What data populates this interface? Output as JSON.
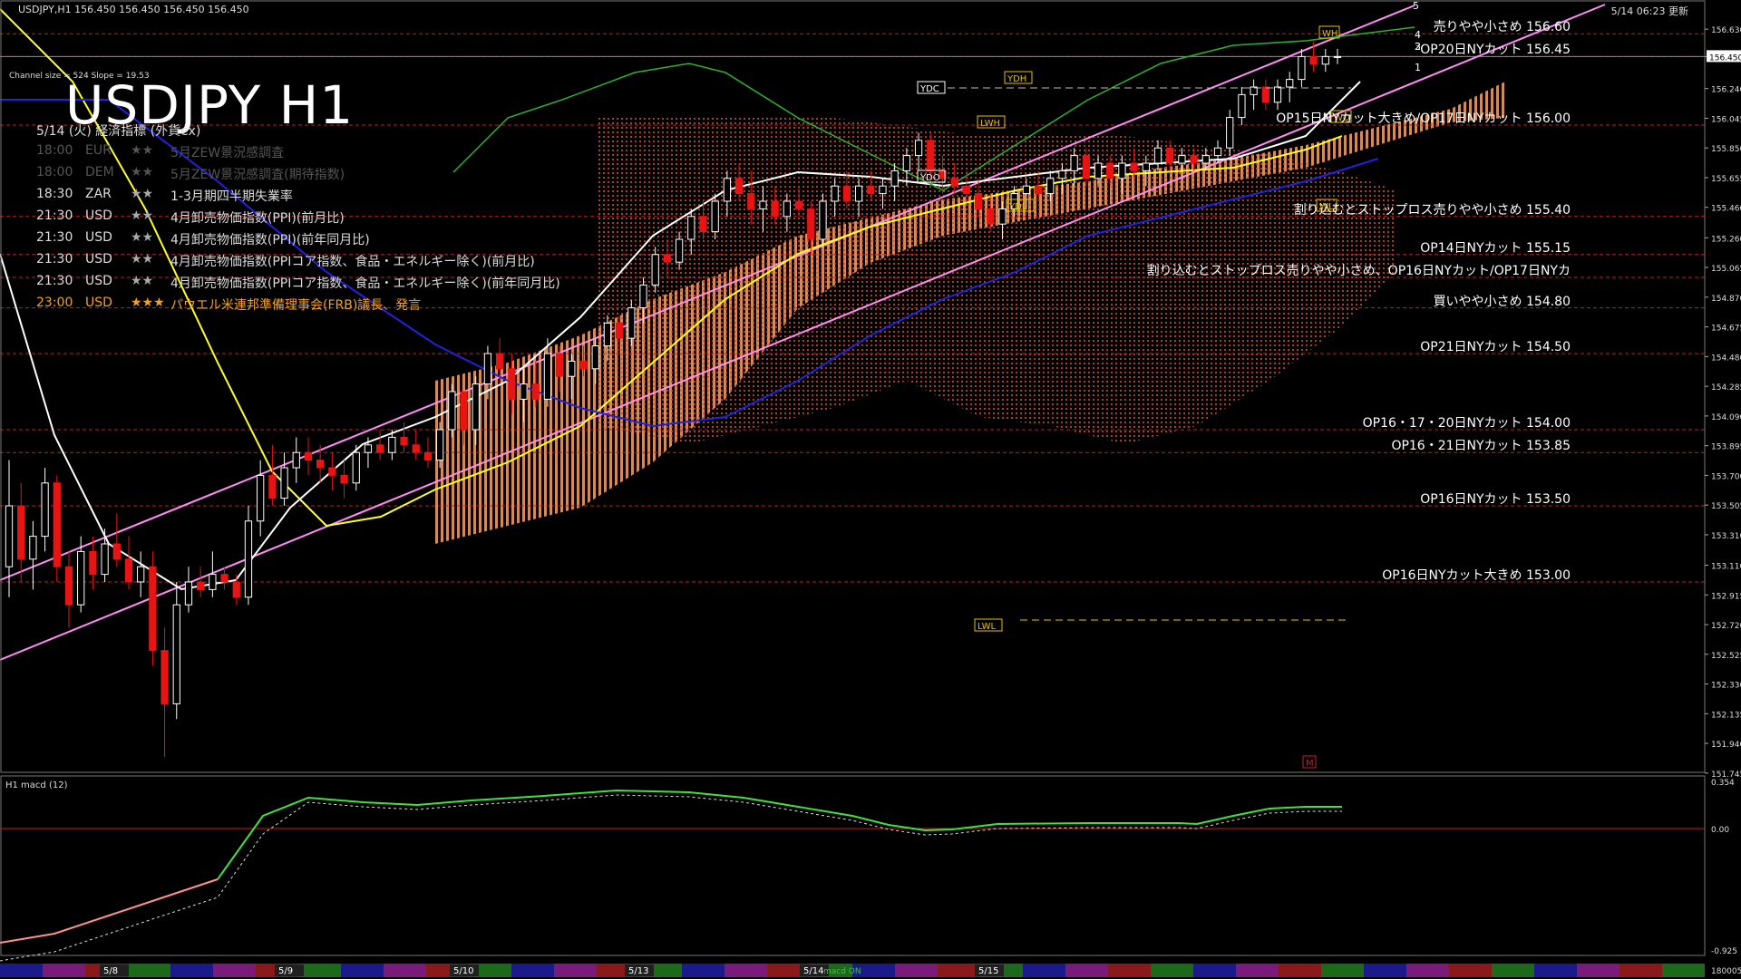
{
  "header": {
    "symbol_info": "USDJPY,H1  156.450 156.450 156.450 156.450",
    "channel_info": "Channel size = 524 Slope = 19.53",
    "title": "USDJPY H1",
    "timestamp": "5/14 06:23 更新"
  },
  "events": {
    "heading": "5/14 (火) 経済指標 (外貨ex)",
    "items": [
      {
        "time": "18:00",
        "ccy": "EUR",
        "stars": "★★",
        "text": "5月ZEW景況感調査",
        "past": true,
        "gold": false
      },
      {
        "time": "18:00",
        "ccy": "DEM",
        "stars": "★★",
        "text": "5月ZEW景況感調査(期待指数)",
        "past": true,
        "gold": false
      },
      {
        "time": "18:30",
        "ccy": "ZAR",
        "stars": "★★",
        "text": "1-3月期四半期失業率",
        "past": false,
        "gold": false
      },
      {
        "time": "21:30",
        "ccy": "USD",
        "stars": "★★",
        "text": "4月卸売物価指数(PPI)(前月比)",
        "past": false,
        "gold": false
      },
      {
        "time": "21:30",
        "ccy": "USD",
        "stars": "★★",
        "text": "4月卸売物価指数(PPI)(前年同月比)",
        "past": false,
        "gold": false
      },
      {
        "time": "21:30",
        "ccy": "USD",
        "stars": "★★",
        "text": "4月卸売物価指数(PPIコア指数、食品・エネルギー除く)(前月比)",
        "past": false,
        "gold": false
      },
      {
        "time": "21:30",
        "ccy": "USD",
        "stars": "★★",
        "text": "4月卸売物価指数(PPIコア指数、食品・エネルギー除く)(前年同月比)",
        "past": false,
        "gold": false
      },
      {
        "time": "23:00",
        "ccy": "USD",
        "stars": "★★★",
        "text": "パウエル米連邦準備理事会(FRB)議長、発言",
        "past": false,
        "gold": true
      }
    ]
  },
  "levels": [
    {
      "price": 156.6,
      "text": "売りやや小さめ 156.60"
    },
    {
      "price": 156.45,
      "text": "OP20日NYカット 156.45"
    },
    {
      "price": 156.0,
      "text": "OP15日NYカット大きめ/OP17日NYカット 156.00"
    },
    {
      "price": 155.4,
      "text": "割り込むとストップロス売りやや小さめ 155.40"
    },
    {
      "price": 155.15,
      "text": "OP14日NYカット 155.15"
    },
    {
      "price": 155.0,
      "text": "割り込むとストップロス売りやや小さめ、OP16日NYカット/OP17日NYカ"
    },
    {
      "price": 154.8,
      "text": "買いやや小さめ 154.80"
    },
    {
      "price": 154.5,
      "text": "OP21日NYカット 154.50"
    },
    {
      "price": 154.0,
      "text": "OP16・17・20日NYカット 154.00"
    },
    {
      "price": 153.85,
      "text": "OP16・21日NYカット 153.85"
    },
    {
      "price": 153.5,
      "text": "OP16日NYカット 153.50"
    },
    {
      "price": 153.0,
      "text": "OP16日NYカット大きめ 153.00"
    }
  ],
  "markers": {
    "ydh": "YDH",
    "ydc": "YDC",
    "ydo": "YDO",
    "ydl": "YDL",
    "lwh": "LWH",
    "lwl": "LWL",
    "wh": "WH",
    "wo": "WO",
    "wl": "WL",
    "m": "M",
    "pivot_1": "1",
    "pivot_2": "2",
    "pivot_3": "3",
    "pivot_4": "4",
    "pivot_5": "5"
  },
  "macd": {
    "label": "H1  macd (12)",
    "axis": [
      "0.354",
      "0.00",
      "-0.925"
    ],
    "bottom_value": "180005",
    "bottom_tag": "macd ON"
  },
  "colors": {
    "background": "#000000",
    "bull_candle": "#ffffff",
    "bear_candle": "#e81414",
    "cloud_bull": "#f7a46a",
    "cloud_bear": "#d0502a",
    "channel": "#ff8cf0",
    "ma_fast": "#ffffff",
    "ma_mid": "#ffff22",
    "ma_slow": "#2222dd",
    "level_line": "#c02020",
    "macd_line": "#40e040",
    "macd_neg": "#ff7070"
  },
  "chart_data": {
    "type": "candlestick",
    "title": "USDJPY H1",
    "ylim": [
      151.75,
      156.75
    ],
    "y_ticks": [
      "156.630",
      "156.450",
      "156.240",
      "156.045",
      "155.850",
      "155.655",
      "155.460",
      "155.260",
      "155.065",
      "154.870",
      "154.675",
      "154.480",
      "154.285",
      "154.090",
      "153.895",
      "153.700",
      "153.505",
      "153.310",
      "153.110",
      "152.915",
      "152.720",
      "152.525",
      "152.330",
      "152.135",
      "151.940",
      "151.745"
    ],
    "current_price": "156.450",
    "day_labels": [
      "5/8",
      "5/9",
      "5/10",
      "5/13",
      "5/14",
      "5/15"
    ],
    "candles": [
      {
        "o": 153.1,
        "h": 153.8,
        "l": 152.9,
        "c": 153.5
      },
      {
        "o": 153.5,
        "h": 153.65,
        "l": 153.0,
        "c": 153.15
      },
      {
        "o": 153.15,
        "h": 153.4,
        "l": 152.95,
        "c": 153.3
      },
      {
        "o": 153.3,
        "h": 153.75,
        "l": 153.2,
        "c": 153.65
      },
      {
        "o": 153.65,
        "h": 153.7,
        "l": 153.0,
        "c": 153.1
      },
      {
        "o": 153.1,
        "h": 153.2,
        "l": 152.7,
        "c": 152.85
      },
      {
        "o": 152.85,
        "h": 153.3,
        "l": 152.8,
        "c": 153.2
      },
      {
        "o": 153.2,
        "h": 153.3,
        "l": 152.95,
        "c": 153.05
      },
      {
        "o": 153.05,
        "h": 153.35,
        "l": 153.0,
        "c": 153.25
      },
      {
        "o": 153.25,
        "h": 153.45,
        "l": 153.1,
        "c": 153.15
      },
      {
        "o": 153.15,
        "h": 153.3,
        "l": 152.95,
        "c": 153.0
      },
      {
        "o": 153.0,
        "h": 153.2,
        "l": 152.9,
        "c": 153.1
      },
      {
        "o": 153.1,
        "h": 153.2,
        "l": 152.45,
        "c": 152.55
      },
      {
        "o": 152.55,
        "h": 152.7,
        "l": 151.85,
        "c": 152.2
      },
      {
        "o": 152.2,
        "h": 153.0,
        "l": 152.1,
        "c": 152.85
      },
      {
        "o": 152.85,
        "h": 153.1,
        "l": 152.8,
        "c": 153.0
      },
      {
        "o": 153.0,
        "h": 153.1,
        "l": 152.9,
        "c": 152.95
      },
      {
        "o": 152.95,
        "h": 153.2,
        "l": 152.9,
        "c": 153.05
      },
      {
        "o": 153.05,
        "h": 153.1,
        "l": 152.95,
        "c": 153.0
      },
      {
        "o": 153.0,
        "h": 153.05,
        "l": 152.85,
        "c": 152.9
      },
      {
        "o": 152.9,
        "h": 153.5,
        "l": 152.85,
        "c": 153.4
      },
      {
        "o": 153.4,
        "h": 153.8,
        "l": 153.3,
        "c": 153.7
      },
      {
        "o": 153.7,
        "h": 153.9,
        "l": 153.5,
        "c": 153.55
      },
      {
        "o": 153.55,
        "h": 153.85,
        "l": 153.5,
        "c": 153.75
      },
      {
        "o": 153.75,
        "h": 153.95,
        "l": 153.65,
        "c": 153.85
      },
      {
        "o": 153.85,
        "h": 153.95,
        "l": 153.7,
        "c": 153.8
      },
      {
        "o": 153.8,
        "h": 153.9,
        "l": 153.65,
        "c": 153.75
      },
      {
        "o": 153.75,
        "h": 153.85,
        "l": 153.6,
        "c": 153.7
      },
      {
        "o": 153.7,
        "h": 153.8,
        "l": 153.55,
        "c": 153.65
      },
      {
        "o": 153.65,
        "h": 153.9,
        "l": 153.6,
        "c": 153.85
      },
      {
        "o": 153.85,
        "h": 153.95,
        "l": 153.75,
        "c": 153.9
      },
      {
        "o": 153.9,
        "h": 154.0,
        "l": 153.8,
        "c": 153.85
      },
      {
        "o": 153.85,
        "h": 154.0,
        "l": 153.8,
        "c": 153.95
      },
      {
        "o": 153.95,
        "h": 154.05,
        "l": 153.85,
        "c": 153.9
      },
      {
        "o": 153.9,
        "h": 154.0,
        "l": 153.8,
        "c": 153.85
      },
      {
        "o": 153.85,
        "h": 153.95,
        "l": 153.75,
        "c": 153.8
      },
      {
        "o": 153.8,
        "h": 154.05,
        "l": 153.75,
        "c": 154.0
      },
      {
        "o": 154.0,
        "h": 154.3,
        "l": 153.95,
        "c": 154.25
      },
      {
        "o": 154.25,
        "h": 154.2,
        "l": 153.9,
        "c": 154.0
      },
      {
        "o": 154.0,
        "h": 154.35,
        "l": 153.9,
        "c": 154.3
      },
      {
        "o": 154.3,
        "h": 154.55,
        "l": 154.2,
        "c": 154.5
      },
      {
        "o": 154.5,
        "h": 154.6,
        "l": 154.3,
        "c": 154.4
      },
      {
        "o": 154.4,
        "h": 154.5,
        "l": 154.1,
        "c": 154.2
      },
      {
        "o": 154.2,
        "h": 154.4,
        "l": 154.05,
        "c": 154.3
      },
      {
        "o": 154.3,
        "h": 154.45,
        "l": 154.15,
        "c": 154.2
      },
      {
        "o": 154.2,
        "h": 154.6,
        "l": 154.15,
        "c": 154.5
      },
      {
        "o": 154.5,
        "h": 154.55,
        "l": 154.25,
        "c": 154.35
      },
      {
        "o": 154.35,
        "h": 154.5,
        "l": 154.2,
        "c": 154.45
      },
      {
        "o": 154.45,
        "h": 154.55,
        "l": 154.35,
        "c": 154.4
      },
      {
        "o": 154.4,
        "h": 154.6,
        "l": 154.3,
        "c": 154.55
      },
      {
        "o": 154.55,
        "h": 154.75,
        "l": 154.45,
        "c": 154.7
      },
      {
        "o": 154.7,
        "h": 154.75,
        "l": 154.5,
        "c": 154.6
      },
      {
        "o": 154.6,
        "h": 154.85,
        "l": 154.55,
        "c": 154.8
      },
      {
        "o": 154.8,
        "h": 155.0,
        "l": 154.7,
        "c": 154.95
      },
      {
        "o": 154.95,
        "h": 155.2,
        "l": 154.9,
        "c": 155.15
      },
      {
        "o": 155.15,
        "h": 155.25,
        "l": 155.0,
        "c": 155.1
      },
      {
        "o": 155.1,
        "h": 155.3,
        "l": 155.05,
        "c": 155.25
      },
      {
        "o": 155.25,
        "h": 155.45,
        "l": 155.15,
        "c": 155.4
      },
      {
        "o": 155.4,
        "h": 155.5,
        "l": 155.25,
        "c": 155.3
      },
      {
        "o": 155.3,
        "h": 155.55,
        "l": 155.25,
        "c": 155.5
      },
      {
        "o": 155.5,
        "h": 155.7,
        "l": 155.4,
        "c": 155.65
      },
      {
        "o": 155.65,
        "h": 155.75,
        "l": 155.5,
        "c": 155.55
      },
      {
        "o": 155.55,
        "h": 155.7,
        "l": 155.35,
        "c": 155.45
      },
      {
        "o": 155.45,
        "h": 155.6,
        "l": 155.3,
        "c": 155.5
      },
      {
        "o": 155.5,
        "h": 155.6,
        "l": 155.35,
        "c": 155.4
      },
      {
        "o": 155.4,
        "h": 155.55,
        "l": 155.3,
        "c": 155.5
      },
      {
        "o": 155.5,
        "h": 155.6,
        "l": 155.4,
        "c": 155.45
      },
      {
        "o": 155.45,
        "h": 155.5,
        "l": 155.15,
        "c": 155.25
      },
      {
        "o": 155.25,
        "h": 155.55,
        "l": 155.2,
        "c": 155.5
      },
      {
        "o": 155.5,
        "h": 155.65,
        "l": 155.4,
        "c": 155.6
      },
      {
        "o": 155.6,
        "h": 155.7,
        "l": 155.45,
        "c": 155.5
      },
      {
        "o": 155.5,
        "h": 155.65,
        "l": 155.4,
        "c": 155.6
      },
      {
        "o": 155.6,
        "h": 155.7,
        "l": 155.5,
        "c": 155.55
      },
      {
        "o": 155.55,
        "h": 155.65,
        "l": 155.45,
        "c": 155.6
      },
      {
        "o": 155.6,
        "h": 155.75,
        "l": 155.5,
        "c": 155.7
      },
      {
        "o": 155.7,
        "h": 155.85,
        "l": 155.6,
        "c": 155.8
      },
      {
        "o": 155.8,
        "h": 155.95,
        "l": 155.7,
        "c": 155.9
      },
      {
        "o": 155.9,
        "h": 155.95,
        "l": 155.65,
        "c": 155.7
      },
      {
        "o": 155.7,
        "h": 155.8,
        "l": 155.55,
        "c": 155.65
      },
      {
        "o": 155.65,
        "h": 155.75,
        "l": 155.55,
        "c": 155.6
      },
      {
        "o": 155.6,
        "h": 155.7,
        "l": 155.5,
        "c": 155.55
      },
      {
        "o": 155.55,
        "h": 155.65,
        "l": 155.4,
        "c": 155.45
      },
      {
        "o": 155.45,
        "h": 155.55,
        "l": 155.3,
        "c": 155.35
      },
      {
        "o": 155.35,
        "h": 155.5,
        "l": 155.25,
        "c": 155.45
      },
      {
        "o": 155.45,
        "h": 155.6,
        "l": 155.4,
        "c": 155.55
      },
      {
        "o": 155.55,
        "h": 155.65,
        "l": 155.45,
        "c": 155.6
      },
      {
        "o": 155.6,
        "h": 155.7,
        "l": 155.5,
        "c": 155.55
      },
      {
        "o": 155.55,
        "h": 155.7,
        "l": 155.5,
        "c": 155.65
      },
      {
        "o": 155.65,
        "h": 155.75,
        "l": 155.55,
        "c": 155.7
      },
      {
        "o": 155.7,
        "h": 155.85,
        "l": 155.6,
        "c": 155.8
      },
      {
        "o": 155.8,
        "h": 155.85,
        "l": 155.6,
        "c": 155.65
      },
      {
        "o": 155.65,
        "h": 155.8,
        "l": 155.6,
        "c": 155.75
      },
      {
        "o": 155.75,
        "h": 155.8,
        "l": 155.6,
        "c": 155.65
      },
      {
        "o": 155.65,
        "h": 155.8,
        "l": 155.55,
        "c": 155.75
      },
      {
        "o": 155.75,
        "h": 155.85,
        "l": 155.65,
        "c": 155.7
      },
      {
        "o": 155.7,
        "h": 155.8,
        "l": 155.6,
        "c": 155.75
      },
      {
        "o": 155.75,
        "h": 155.9,
        "l": 155.7,
        "c": 155.85
      },
      {
        "o": 155.85,
        "h": 155.9,
        "l": 155.7,
        "c": 155.75
      },
      {
        "o": 155.75,
        "h": 155.85,
        "l": 155.7,
        "c": 155.8
      },
      {
        "o": 155.8,
        "h": 155.85,
        "l": 155.7,
        "c": 155.75
      },
      {
        "o": 155.75,
        "h": 155.85,
        "l": 155.7,
        "c": 155.8
      },
      {
        "o": 155.8,
        "h": 155.9,
        "l": 155.75,
        "c": 155.85
      },
      {
        "o": 155.85,
        "h": 156.1,
        "l": 155.8,
        "c": 156.05
      },
      {
        "o": 156.05,
        "h": 156.25,
        "l": 156.0,
        "c": 156.2
      },
      {
        "o": 156.2,
        "h": 156.3,
        "l": 156.1,
        "c": 156.25
      },
      {
        "o": 156.25,
        "h": 156.3,
        "l": 156.1,
        "c": 156.15
      },
      {
        "o": 156.15,
        "h": 156.3,
        "l": 156.1,
        "c": 156.25
      },
      {
        "o": 156.25,
        "h": 156.35,
        "l": 156.15,
        "c": 156.3
      },
      {
        "o": 156.3,
        "h": 156.5,
        "l": 156.25,
        "c": 156.45
      },
      {
        "o": 156.45,
        "h": 156.55,
        "l": 156.35,
        "c": 156.4
      },
      {
        "o": 156.4,
        "h": 156.5,
        "l": 156.35,
        "c": 156.45
      },
      {
        "o": 156.45,
        "h": 156.5,
        "l": 156.4,
        "c": 156.45
      }
    ]
  }
}
